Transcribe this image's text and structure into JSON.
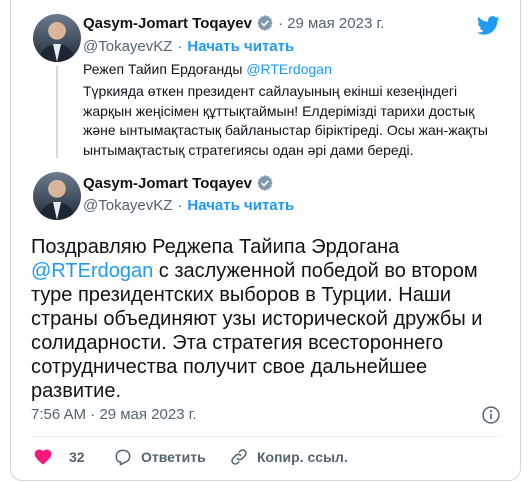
{
  "quoted_tweet": {
    "author_name": "Qasym-Jomart Toqayev",
    "date": "· 29 мая 2023 г.",
    "handle": "@TokayevKZ",
    "sep": "·",
    "follow_label": "Начать читать",
    "line1_prefix": "Режеп Тайип Ердоғанды ",
    "line1_mention": "@RTErdogan",
    "body": "Түркияда өткен президент сайлауының екінші кезеңіндегі жарқын жеңісімен құттықтаймын! Елдерімізді тарихи достық және ынтымақтастық байланыстар біріктіреді. Осы жан-жақты ынтымақтастық стратегиясы одан әрі дами береді."
  },
  "main_tweet": {
    "author_name": "Qasym-Jomart Toqayev",
    "handle": "@TokayevKZ",
    "sep": "·",
    "follow_label": "Начать читать",
    "text_prefix": "Поздравляю Реджепа Тайипа Эрдогана ",
    "text_mention": "@RTErdogan",
    "text_suffix": " с заслуженной победой во втором туре президентских выборов в Турции. Наши страны объединяют узы исторической дружбы и солидарности. Эта стратегия всестороннего сотрудничества получит свое дальнейшее развитие.",
    "timestamp": "7:56 AM · 29 мая 2023 г."
  },
  "actions": {
    "like_count": "32",
    "reply_label": "Ответить",
    "copy_label": "Копир. ссыл."
  },
  "colors": {
    "accent": "#1d9bf0",
    "like": "#f91880",
    "muted": "#536471",
    "verified": "#829aab"
  }
}
